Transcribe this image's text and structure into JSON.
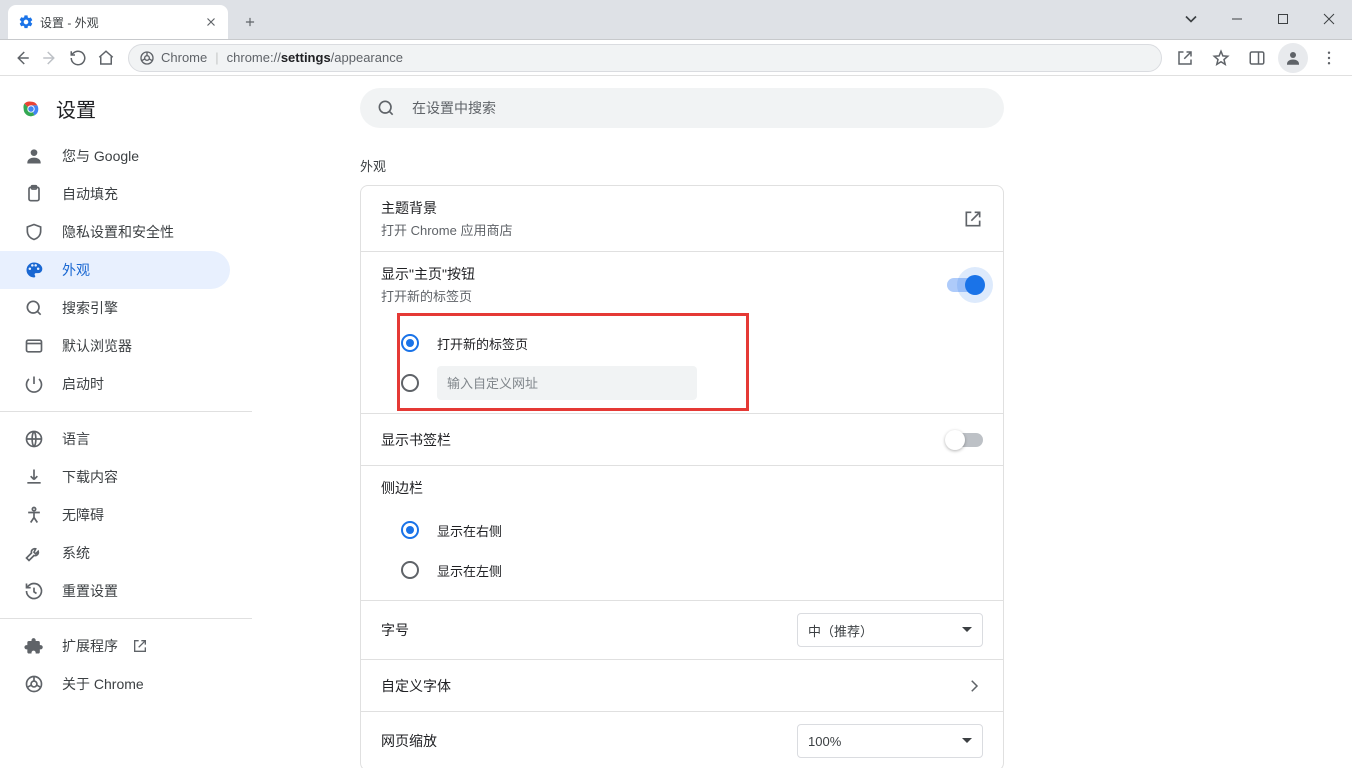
{
  "tab": {
    "title": "设置 - 外观"
  },
  "omnibox": {
    "chip": "Chrome",
    "url_pre": "chrome://",
    "url_bold": "settings",
    "url_post": "/appearance"
  },
  "sidebar": {
    "title": "设置",
    "items": [
      {
        "label": "您与 Google"
      },
      {
        "label": "自动填充"
      },
      {
        "label": "隐私设置和安全性"
      },
      {
        "label": "外观"
      },
      {
        "label": "搜索引擎"
      },
      {
        "label": "默认浏览器"
      },
      {
        "label": "启动时"
      }
    ],
    "items2": [
      {
        "label": "语言"
      },
      {
        "label": "下载内容"
      },
      {
        "label": "无障碍"
      },
      {
        "label": "系统"
      },
      {
        "label": "重置设置"
      }
    ],
    "extensions": "扩展程序",
    "about": "关于 Chrome"
  },
  "search_placeholder": "在设置中搜索",
  "section": "外观",
  "theme": {
    "title": "主题背景",
    "sub": "打开 Chrome 应用商店"
  },
  "home_button": {
    "title": "显示\"主页\"按钮",
    "sub": "打开新的标签页"
  },
  "home_radio": {
    "newtab": "打开新的标签页",
    "url_placeholder": "输入自定义网址"
  },
  "bookmarks_bar": {
    "title": "显示书签栏"
  },
  "side_panel": {
    "title": "侧边栏",
    "right": "显示在右侧",
    "left": "显示在左侧"
  },
  "font_size": {
    "title": "字号",
    "value": "中（推荐）"
  },
  "custom_font": {
    "title": "自定义字体"
  },
  "zoom": {
    "title": "网页缩放",
    "value": "100%"
  }
}
